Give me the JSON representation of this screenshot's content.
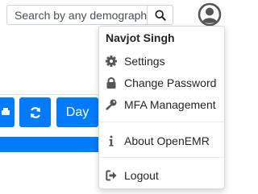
{
  "search": {
    "placeholder": "Search by any demographics"
  },
  "toolbar": {
    "day_label": "Day"
  },
  "user_menu": {
    "user_name": "Navjot Singh",
    "items": [
      {
        "label": "Settings",
        "icon": "gear-icon"
      },
      {
        "label": "Change Password",
        "icon": "lock-icon"
      },
      {
        "label": "MFA Management",
        "icon": "key-icon"
      },
      {
        "label": "About OpenEMR",
        "icon": "info-icon"
      },
      {
        "label": "Logout",
        "icon": "sign-out-icon"
      }
    ]
  },
  "colors": {
    "primary": "#007bff",
    "icon_gray": "#555555"
  }
}
